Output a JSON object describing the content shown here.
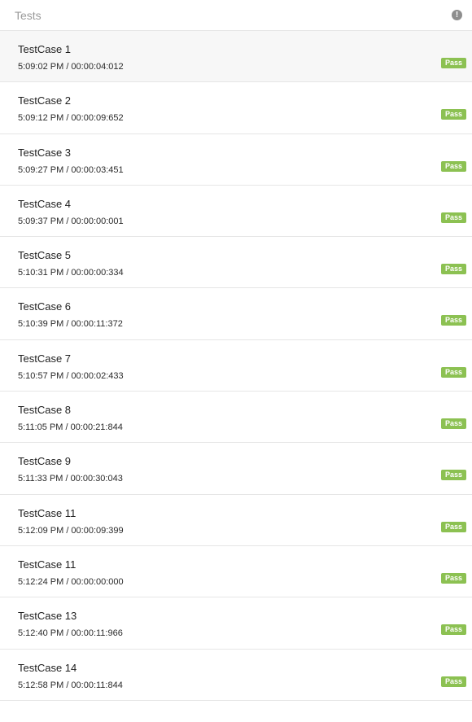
{
  "header": {
    "title": "Tests",
    "info_icon": "exclamation-circle-icon"
  },
  "badge_color": "#8cc152",
  "tests": [
    {
      "name": "TestCase 1",
      "meta": "5:09:02 PM / 00:00:04:012",
      "status": "Pass"
    },
    {
      "name": "TestCase 2",
      "meta": "5:09:12 PM / 00:00:09:652",
      "status": "Pass"
    },
    {
      "name": "TestCase 3",
      "meta": "5:09:27 PM / 00:00:03:451",
      "status": "Pass"
    },
    {
      "name": "TestCase 4",
      "meta": "5:09:37 PM / 00:00:00:001",
      "status": "Pass"
    },
    {
      "name": "TestCase 5",
      "meta": "5:10:31 PM / 00:00:00:334",
      "status": "Pass"
    },
    {
      "name": "TestCase 6",
      "meta": "5:10:39 PM / 00:00:11:372",
      "status": "Pass"
    },
    {
      "name": "TestCase 7",
      "meta": "5:10:57 PM / 00:00:02:433",
      "status": "Pass"
    },
    {
      "name": "TestCase 8",
      "meta": "5:11:05 PM / 00:00:21:844",
      "status": "Pass"
    },
    {
      "name": "TestCase 9",
      "meta": "5:11:33 PM / 00:00:30:043",
      "status": "Pass"
    },
    {
      "name": "TestCase 11",
      "meta": "5:12:09 PM / 00:00:09:399",
      "status": "Pass"
    },
    {
      "name": "TestCase 11",
      "meta": "5:12:24 PM / 00:00:00:000",
      "status": "Pass"
    },
    {
      "name": "TestCase 13",
      "meta": "5:12:40 PM / 00:00:11:966",
      "status": "Pass"
    },
    {
      "name": "TestCase 14",
      "meta": "5:12:58 PM / 00:00:11:844",
      "status": "Pass"
    }
  ]
}
